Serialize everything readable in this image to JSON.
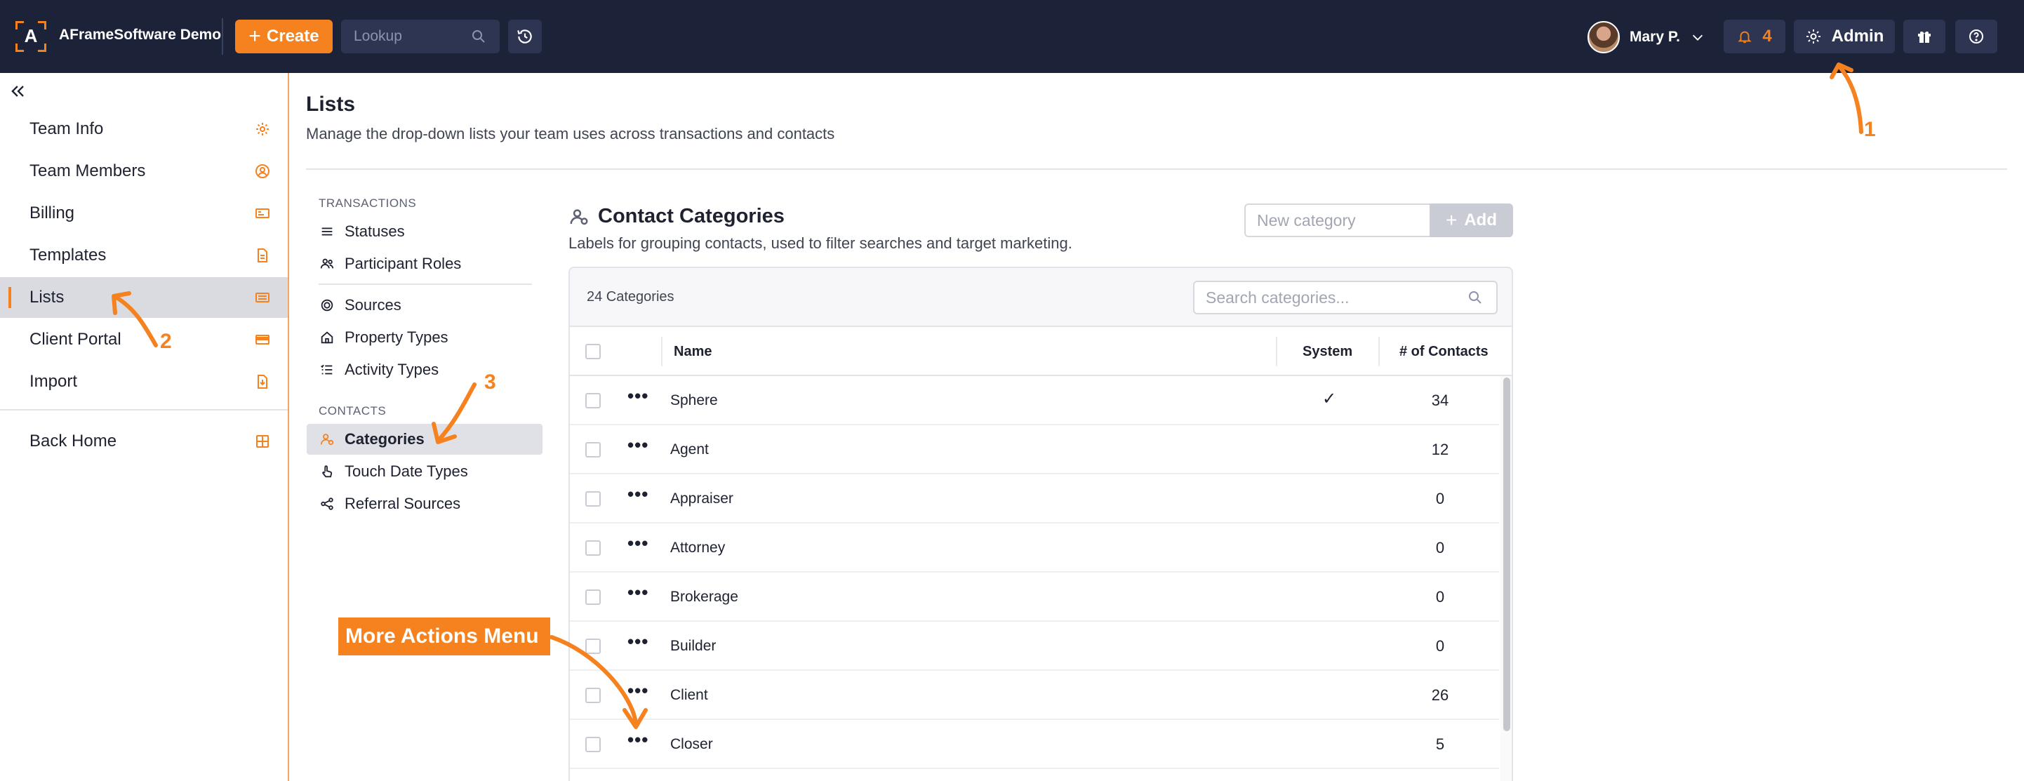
{
  "topbar": {
    "brand": "AFrameSoftware Demo",
    "logo_letter": "A",
    "create_label": "Create",
    "lookup_placeholder": "Lookup",
    "user_name": "Mary P.",
    "notification_count": "4",
    "admin_label": "Admin",
    "accent_color": "#f5821f",
    "bar_color": "#1c2238"
  },
  "sidebar": {
    "items": [
      {
        "label": "Team Info",
        "icon": "gear-icon"
      },
      {
        "label": "Team Members",
        "icon": "user-circle-icon"
      },
      {
        "label": "Billing",
        "icon": "billing-icon"
      },
      {
        "label": "Templates",
        "icon": "document-icon"
      },
      {
        "label": "Lists",
        "icon": "list-icon",
        "active": true
      },
      {
        "label": "Client Portal",
        "icon": "card-icon"
      },
      {
        "label": "Import",
        "icon": "import-icon"
      }
    ],
    "back_home": {
      "label": "Back Home",
      "icon": "grid-icon"
    }
  },
  "page": {
    "title": "Lists",
    "subtitle": "Manage the drop-down lists your team uses across transactions and contacts"
  },
  "subnav": {
    "transactions_heading": "TRANSACTIONS",
    "transactions": [
      {
        "label": "Statuses",
        "icon": "statuses-icon"
      },
      {
        "label": "Participant Roles",
        "icon": "people-icon"
      },
      {
        "label": "Sources",
        "icon": "target-icon"
      },
      {
        "label": "Property Types",
        "icon": "home-icon"
      },
      {
        "label": "Activity Types",
        "icon": "checklist-icon"
      }
    ],
    "contacts_heading": "CONTACTS",
    "contacts": [
      {
        "label": "Categories",
        "icon": "person-tag-icon",
        "active": true
      },
      {
        "label": "Touch Date Types",
        "icon": "hand-icon"
      },
      {
        "label": "Referral Sources",
        "icon": "share-icon"
      }
    ]
  },
  "categories": {
    "title": "Contact Categories",
    "description": "Labels for grouping contacts, used to filter searches and target marketing.",
    "new_placeholder": "New category",
    "add_label": "Add",
    "count_label": "24 Categories",
    "search_placeholder": "Search categories...",
    "columns": {
      "name": "Name",
      "system": "System",
      "contacts": "# of Contacts"
    },
    "rows": [
      {
        "name": "Sphere",
        "system": "✓",
        "contacts": "34"
      },
      {
        "name": "Agent",
        "system": "",
        "contacts": "12"
      },
      {
        "name": "Appraiser",
        "system": "",
        "contacts": "0"
      },
      {
        "name": "Attorney",
        "system": "",
        "contacts": "0"
      },
      {
        "name": "Brokerage",
        "system": "",
        "contacts": "0"
      },
      {
        "name": "Builder",
        "system": "",
        "contacts": "0"
      },
      {
        "name": "Client",
        "system": "",
        "contacts": "26"
      },
      {
        "name": "Closer",
        "system": "",
        "contacts": "5"
      }
    ]
  },
  "annotations": {
    "marker_1": "1",
    "marker_2": "2",
    "marker_3": "3",
    "callout": "More Actions Menu"
  }
}
